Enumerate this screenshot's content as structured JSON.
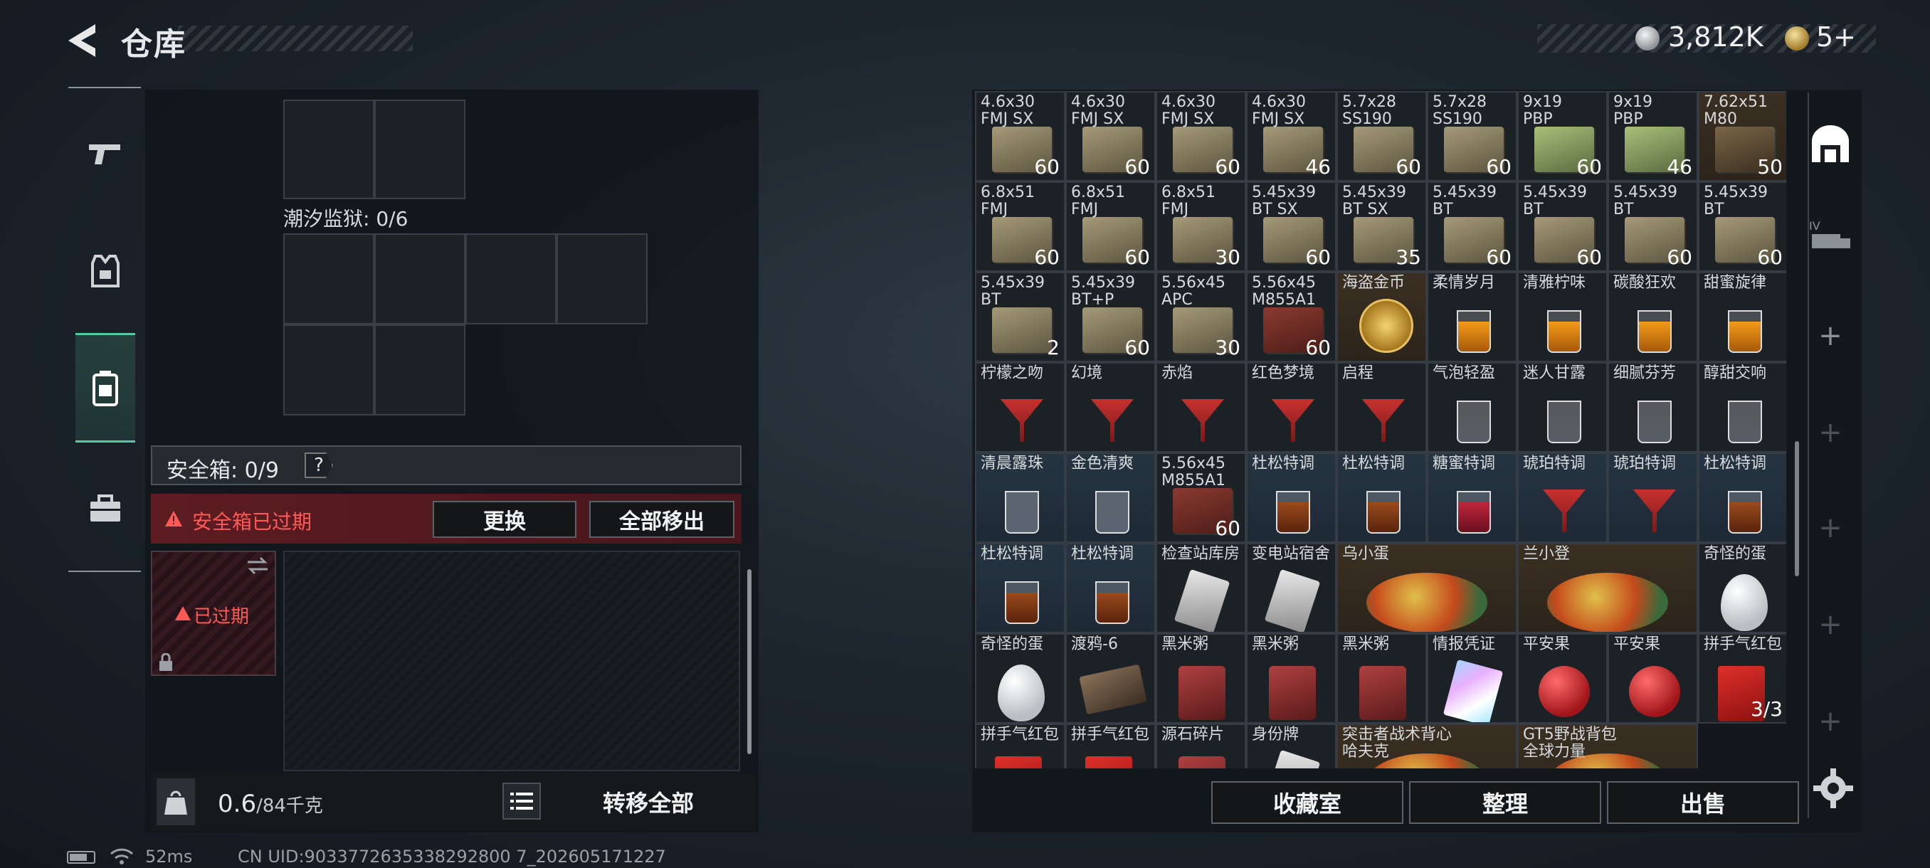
{
  "header": {
    "title": "仓库",
    "currency_1": "3,812K",
    "currency_2": "5+"
  },
  "left": {
    "prison_label": "潮汐监狱: 0/6",
    "safe_box_label": "安全箱: 0/9",
    "help": "?",
    "expired_warning": "安全箱已过期",
    "replace_btn": "更换",
    "move_all_btn": "全部移出",
    "case_status": "已过期",
    "weight_value": "0.6",
    "weight_unit": "/84千克",
    "transfer_all": "转移全部"
  },
  "inventory": {
    "rows": [
      [
        [
          "4.6x30\nFMJ SX",
          "60"
        ],
        [
          "4.6x30\nFMJ SX",
          "60"
        ],
        [
          "4.6x30\nFMJ SX",
          "60"
        ],
        [
          "4.6x30\nFMJ SX",
          "46"
        ],
        [
          "5.7x28\nSS190",
          "60"
        ],
        [
          "5.7x28\nSS190",
          "60"
        ],
        [
          "9x19\nPBP",
          "60"
        ],
        [
          "9x19\nPBP",
          "46"
        ],
        [
          "7.62x51\nM80",
          "50"
        ]
      ],
      [
        [
          "6.8x51\nFMJ",
          "60"
        ],
        [
          "6.8x51\nFMJ",
          "60"
        ],
        [
          "6.8x51\nFMJ",
          "30"
        ],
        [
          "5.45x39\nBT SX",
          "60"
        ],
        [
          "5.45x39\nBT SX",
          "35"
        ],
        [
          "5.45x39\nBT",
          "60"
        ],
        [
          "5.45x39\nBT",
          "60"
        ],
        [
          "5.45x39\nBT",
          "60"
        ],
        [
          "5.45x39\nBT",
          "60"
        ]
      ],
      [
        [
          "5.45x39\nBT",
          "2"
        ],
        [
          "5.45x39\nBT+P",
          "60"
        ],
        [
          "5.56x45\nAPC",
          "30"
        ],
        [
          "5.56x45\nM855A1",
          "60"
        ],
        [
          "海盗金币",
          ""
        ],
        [
          "柔情岁月",
          ""
        ],
        [
          "清雅柠味",
          ""
        ],
        [
          "碳酸狂欢",
          ""
        ],
        [
          "甜蜜旋律",
          ""
        ]
      ],
      [
        [
          "柠檬之吻",
          ""
        ],
        [
          "幻境",
          ""
        ],
        [
          "赤焰",
          ""
        ],
        [
          "红色梦境",
          ""
        ],
        [
          "启程",
          ""
        ],
        [
          "气泡轻盈",
          ""
        ],
        [
          "迷人甘露",
          ""
        ],
        [
          "细腻芬芳",
          ""
        ],
        [
          "醇甜交响",
          ""
        ]
      ],
      [
        [
          "清晨露珠",
          ""
        ],
        [
          "金色清爽",
          ""
        ],
        [
          "5.56x45\nM855A1",
          "60"
        ],
        [
          "杜松特调",
          ""
        ],
        [
          "杜松特调",
          ""
        ],
        [
          "糖蜜特调",
          ""
        ],
        [
          "琥珀特调",
          ""
        ],
        [
          "琥珀特调",
          ""
        ],
        [
          "杜松特调",
          ""
        ]
      ],
      [
        [
          "杜松特调",
          ""
        ],
        [
          "杜松特调",
          ""
        ],
        [
          "检查站库房",
          ""
        ],
        [
          "变电站宿舍",
          ""
        ],
        [
          "乌小蛋",
          ""
        ],
        [
          "兰小登",
          ""
        ],
        [
          "奇怪的蛋",
          ""
        ]
      ],
      [
        [
          "奇怪的蛋",
          ""
        ],
        [
          "渡鸦-6",
          ""
        ],
        [
          "黑米粥",
          ""
        ],
        [
          "黑米粥",
          ""
        ],
        [
          "黑米粥",
          ""
        ],
        [
          "情报凭证",
          ""
        ],
        [
          "平安果",
          ""
        ],
        [
          "平安果",
          ""
        ],
        [
          "拼手气红包",
          "3/3"
        ]
      ],
      [
        [
          "拼手气红包",
          ""
        ],
        [
          "拼手气红包",
          ""
        ],
        [
          "源石碎片",
          ""
        ],
        [
          "身份牌",
          ""
        ],
        [
          "突击者战术背心\n哈夫克",
          ""
        ],
        [
          "GT5野战背包\n全球力量",
          ""
        ]
      ]
    ]
  },
  "actions": {
    "collection": "收藏室",
    "sort": "整理",
    "sell": "出售"
  },
  "status": {
    "ping": "52ms",
    "uid": "CN UID:9033772635338292800 7_202605171227"
  },
  "colors": {
    "accent_green": "#58c8a0",
    "warning_red": "#ff5a56"
  }
}
